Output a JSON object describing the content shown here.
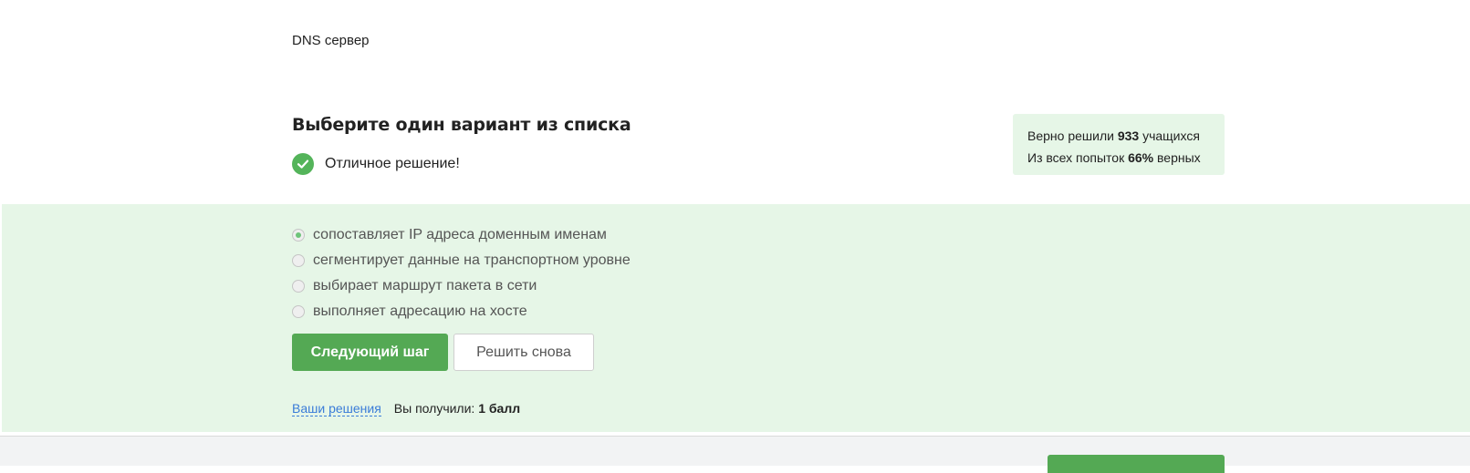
{
  "step": {
    "title": "DNS сервер"
  },
  "quiz": {
    "header": "Выберите один вариант из списка",
    "result": "Отличное решение!",
    "options": [
      {
        "label": "сопоставляет IP адреса доменным именам",
        "selected": true
      },
      {
        "label": "сегментирует данные на транспортном уровне",
        "selected": false
      },
      {
        "label": "выбирает маршрут пакета в сети",
        "selected": false
      },
      {
        "label": "выполняет адресацию на хосте",
        "selected": false
      }
    ]
  },
  "stats": {
    "line1_prefix": "Верно решили",
    "solved_count": "933",
    "line1_suffix": "учащихся",
    "line2_prefix": "Из всех попыток",
    "percent": "66%",
    "line2_suffix": "верных"
  },
  "buttons": {
    "next_label": "Следующий шаг",
    "retry_label": "Решить снова"
  },
  "footer": {
    "solutions_link": "Ваши решения",
    "score_prefix": "Вы получили:",
    "score_value": "1 балл"
  },
  "colors": {
    "accent_green": "#54a954",
    "success_bg": "#e6f6e7",
    "link_blue": "#3a7cd8"
  },
  "icons": {
    "result": "check-circle-icon"
  }
}
